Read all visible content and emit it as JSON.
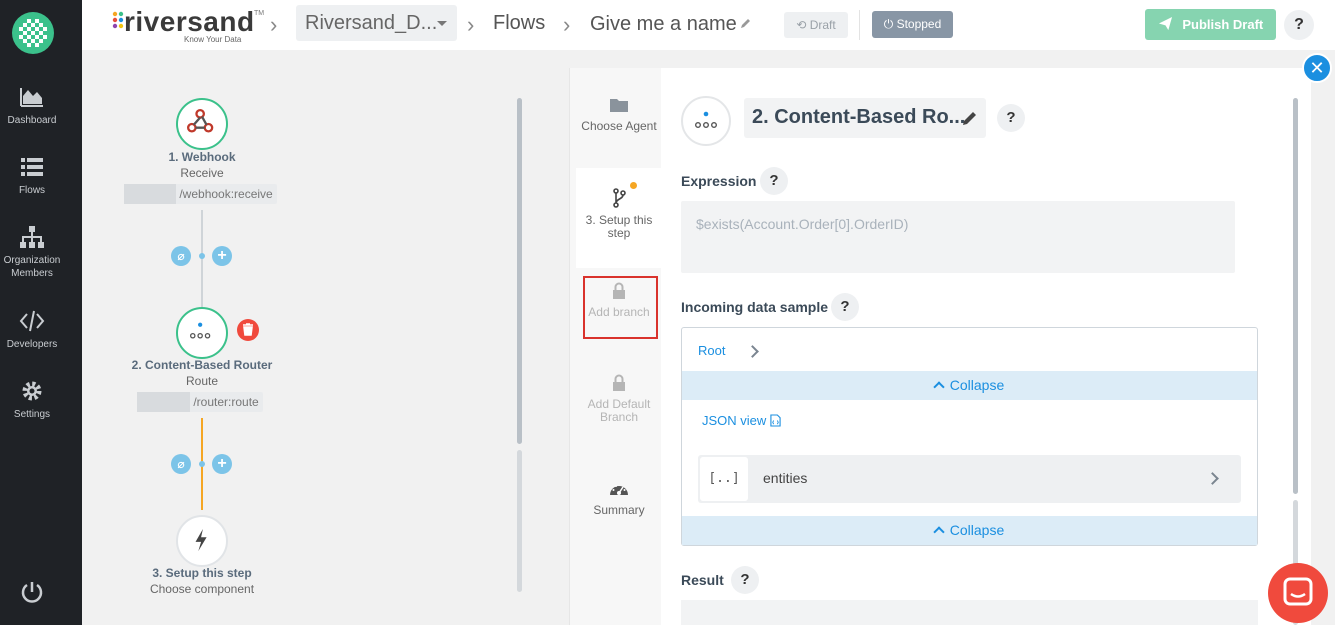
{
  "app": {
    "brand_name": "riversand",
    "brand_tm": "TM",
    "brand_tagline": "Know Your Data",
    "colors": {
      "accent": "#3bc18b",
      "link": "#1b8fe0",
      "sidebar": "#1f2226",
      "orange": "#f5a623",
      "danger": "#f04a3d"
    }
  },
  "sidebar": {
    "items": [
      {
        "label": "Dashboard",
        "icon": "chart-area-icon"
      },
      {
        "label": "Flows",
        "icon": "list-icon"
      },
      {
        "label": "Organization Members",
        "icon": "org-chart-icon"
      },
      {
        "label": "Developers",
        "icon": "code-icon"
      },
      {
        "label": "Settings",
        "icon": "gear-icon"
      }
    ],
    "power_icon": "power-icon"
  },
  "breadcrumb": {
    "workspace": "Riversand_D...",
    "flows": "Flows",
    "flow_name": "Give me a name"
  },
  "toolbar": {
    "draft": "Draft",
    "stopped": "Stopped",
    "publish": "Publish Draft",
    "help": "?"
  },
  "canvas": {
    "nodes": [
      {
        "title": "1. Webhook",
        "subtitle": "Receive",
        "endpoint": "/webhook:receive",
        "icon": "webhook-icon"
      },
      {
        "title": "2. Content-Based Router",
        "subtitle": "Route",
        "endpoint": "/router:route",
        "icon": "router-icon"
      },
      {
        "title": "3. Setup this step",
        "subtitle": "Choose component",
        "icon": "bolt-icon"
      }
    ],
    "add_symbol": "+"
  },
  "steps": {
    "items": [
      {
        "label": "Choose Agent",
        "icon": "folder-icon",
        "state": "enabled"
      },
      {
        "label": "3. Setup this step",
        "icon": "branch-icon",
        "state": "active"
      },
      {
        "label": "Add branch",
        "icon": "lock-icon",
        "state": "disabled"
      },
      {
        "label": "Add Default Branch",
        "icon": "lock-icon",
        "state": "disabled"
      },
      {
        "label": "Summary",
        "icon": "dashboard-gauge-icon",
        "state": "enabled"
      }
    ]
  },
  "panel": {
    "title": "2. Content-Based Ro...",
    "help": "?",
    "expression_label": "Expression",
    "expression_value": "$exists(Account.Order[0].OrderID)",
    "incoming_label": "Incoming data sample",
    "root_label": "Root",
    "collapse_label": "Collapse",
    "json_view_label": "JSON view",
    "entity_icon_text": "[..]",
    "entity_name": "entities",
    "result_label": "Result"
  }
}
